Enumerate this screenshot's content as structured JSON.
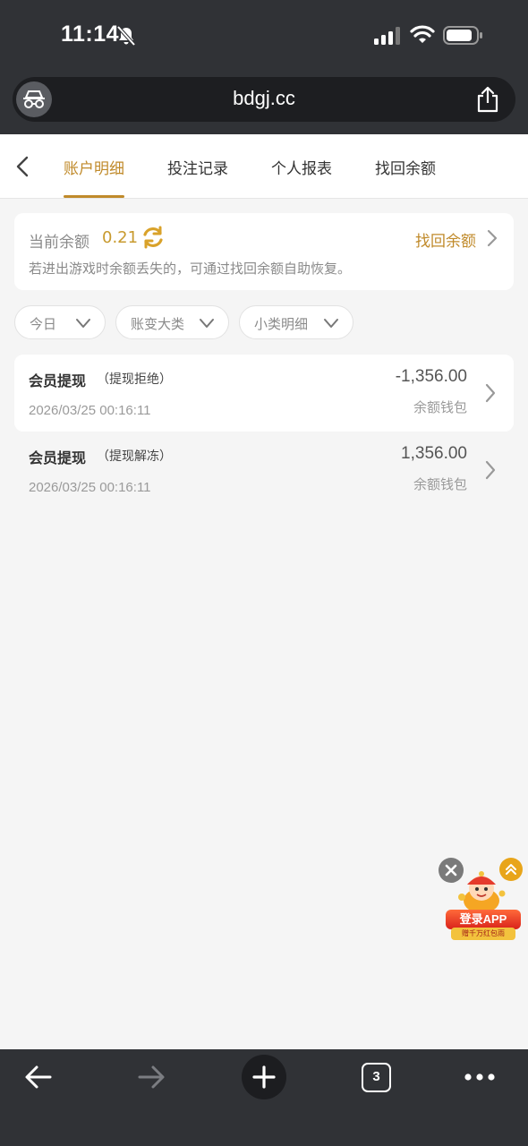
{
  "status_bar": {
    "time": "11:14"
  },
  "browser": {
    "url": "bdgj.cc",
    "tab_count": "3"
  },
  "tabs": [
    {
      "label": "账户明细",
      "active": true
    },
    {
      "label": "投注记录",
      "active": false
    },
    {
      "label": "个人报表",
      "active": false
    },
    {
      "label": "找回余额",
      "active": false
    }
  ],
  "balance": {
    "label": "当前余额",
    "value": "0.21",
    "recover_link": "找回余额",
    "hint": "若进出游戏时余额丢失的，可通过找回余额自助恢复。"
  },
  "filters": [
    {
      "label": "今日"
    },
    {
      "label": "账变大类"
    },
    {
      "label": "小类明细"
    }
  ],
  "transactions": [
    {
      "title": "会员提现",
      "subtype": "（提现拒绝）",
      "time": "2026/03/25 00:16:11",
      "amount": "-1,356.00",
      "wallet": "余额钱包"
    },
    {
      "title": "会员提现",
      "subtype": "（提现解冻）",
      "time": "2026/03/25 00:16:11",
      "amount": "1,356.00",
      "wallet": "余额钱包"
    }
  ],
  "promo": {
    "label": "登录APP",
    "sub": "赠千万红包雨"
  },
  "colors": {
    "accent": "#c08a2a",
    "chrome": "#303236",
    "background": "#f5f5f5"
  }
}
